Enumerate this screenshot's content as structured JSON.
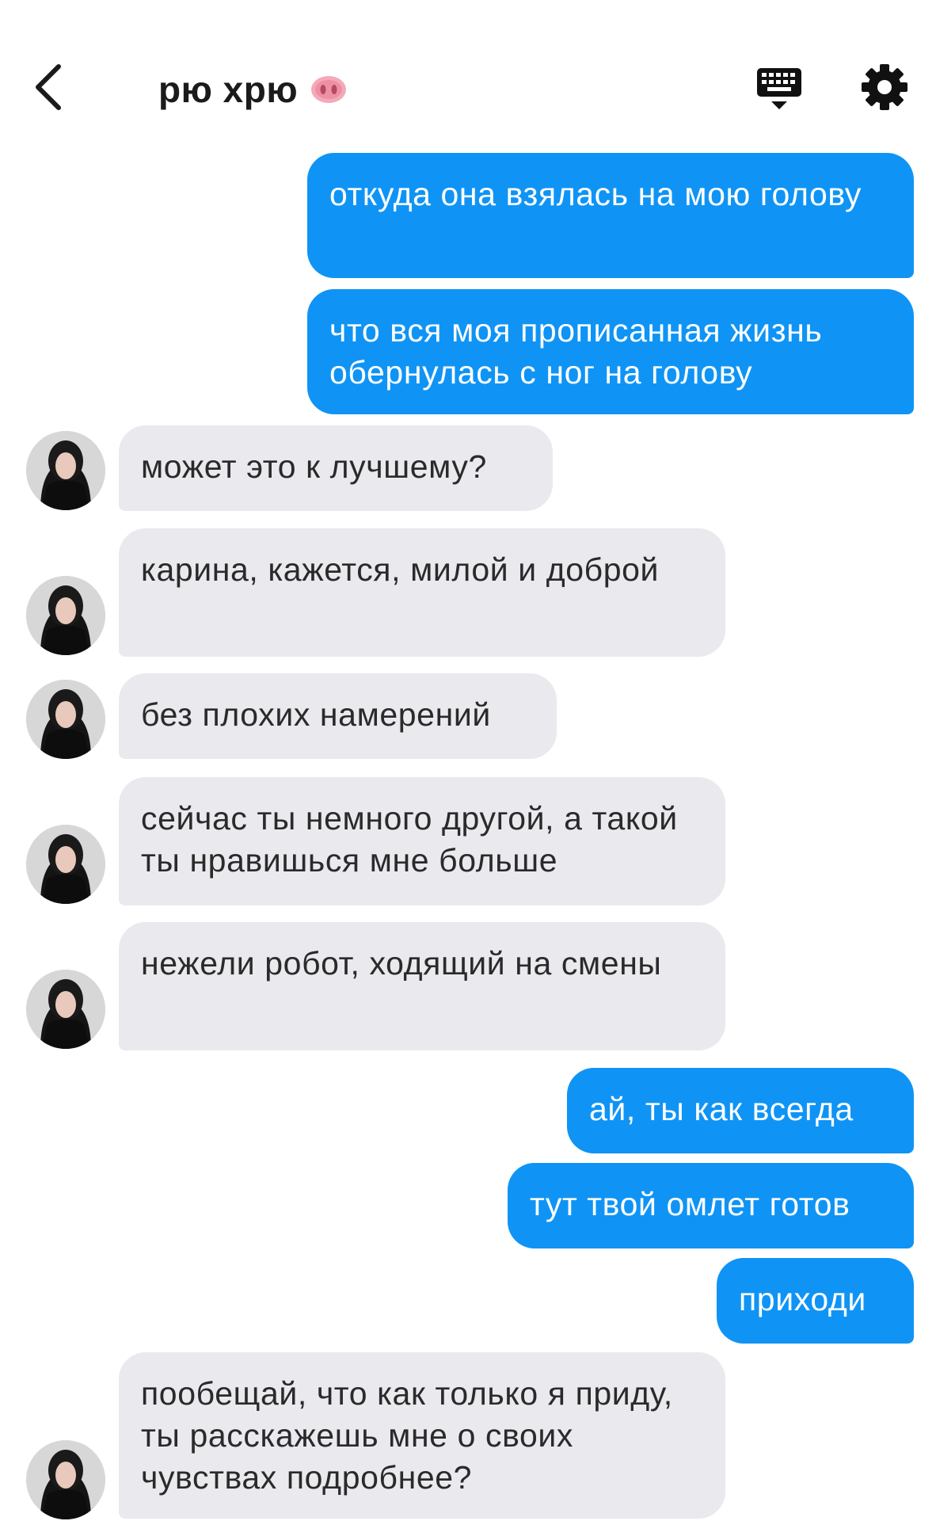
{
  "header": {
    "back_icon": "chevron-left-icon",
    "title": "рю хрю",
    "title_emoji_icon": "pig-nose-icon",
    "keyboard_icon": "keyboard-icon",
    "settings_icon": "gear-icon"
  },
  "colors": {
    "outgoing_bubble": "#0f94f5",
    "incoming_bubble": "#e9e9ee",
    "background": "#ffffff"
  },
  "messages": [
    {
      "side": "outgoing",
      "text": "откуда она взялась на мою голову"
    },
    {
      "side": "outgoing",
      "text": "что вся моя прописанная жизнь обернулась с ног на голову"
    },
    {
      "side": "incoming",
      "text": "может это к лучшему?"
    },
    {
      "side": "incoming",
      "text": "карина, кажется, милой и доброй"
    },
    {
      "side": "incoming",
      "text": "без плохих намерений"
    },
    {
      "side": "incoming",
      "text": "сейчас ты немного другой, а такой ты нравишься мне больше"
    },
    {
      "side": "incoming",
      "text": "нежели робот, ходящий на смены"
    },
    {
      "side": "outgoing",
      "text": "ай, ты как всегда"
    },
    {
      "side": "outgoing",
      "text": "тут твой омлет готов"
    },
    {
      "side": "outgoing",
      "text": "приходи"
    },
    {
      "side": "incoming",
      "text": "пообещай, что как только я приду, ты расскажешь мне о своих чувствах подробнее?"
    }
  ]
}
